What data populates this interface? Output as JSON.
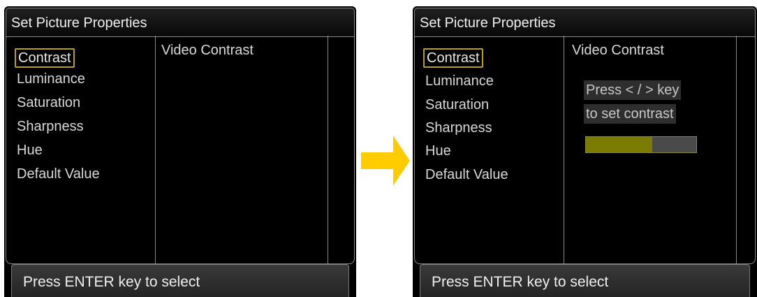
{
  "accent_color": "#b8a11a",
  "arrow_color": "#ffcc00",
  "left_screen": {
    "title": "Set Picture Properties",
    "menu_items": [
      "Contrast",
      "Luminance",
      "Saturation",
      "Sharpness",
      "Hue",
      "Default Value"
    ],
    "selected": "Contrast",
    "info_title": "Video Contrast",
    "status": "Press ENTER key to select"
  },
  "right_screen": {
    "title": "Set Picture Properties",
    "menu_items": [
      "Contrast",
      "Luminance",
      "Saturation",
      "Sharpness",
      "Hue",
      "Default Value"
    ],
    "selected": "Contrast",
    "info_title": "Video Contrast",
    "hint_line1": "Press < / > key",
    "hint_line2": "to set contrast",
    "contrast_level_fraction": 0.6,
    "status": "Press ENTER key to select"
  },
  "transition_icon": "right-arrow-icon"
}
